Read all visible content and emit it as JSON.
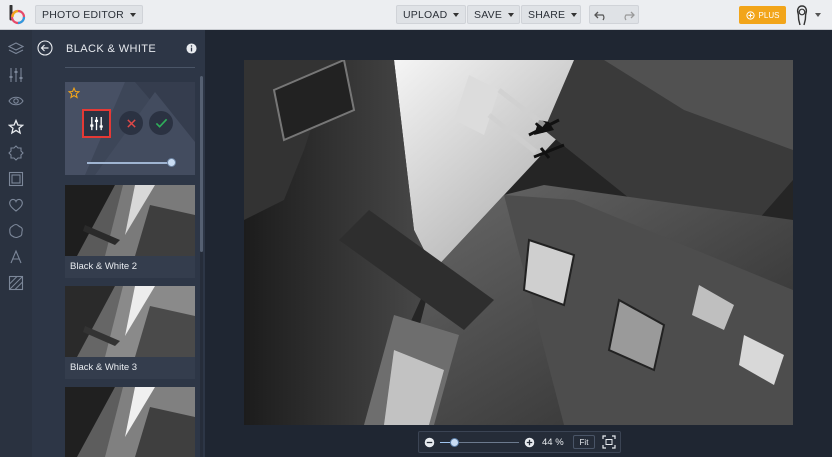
{
  "topbar": {
    "app_menu_label": "PHOTO EDITOR",
    "upload_label": "UPLOAD",
    "save_label": "SAVE",
    "share_label": "SHARE",
    "plus_label": "PLUS"
  },
  "rail": {
    "icons": [
      "layers-icon",
      "sliders-icon",
      "eye-icon",
      "star-icon",
      "badge-icon",
      "frame-icon",
      "heart-icon",
      "shape-icon",
      "text-icon",
      "texture-icon"
    ]
  },
  "panel": {
    "title": "BLACK & WHITE",
    "cards": [
      {
        "label": "Black & White 2"
      },
      {
        "label": "Black & White 3"
      }
    ],
    "slider_value_percent": 100
  },
  "zoom": {
    "value_text": "44 %",
    "fit_label": "Fit",
    "slider_value_percent": 18
  },
  "colors": {
    "accent_plus": "#f2a51a",
    "highlight_red": "#e53935",
    "confirm_green": "#2fae5b",
    "cancel_red": "#e04848"
  }
}
